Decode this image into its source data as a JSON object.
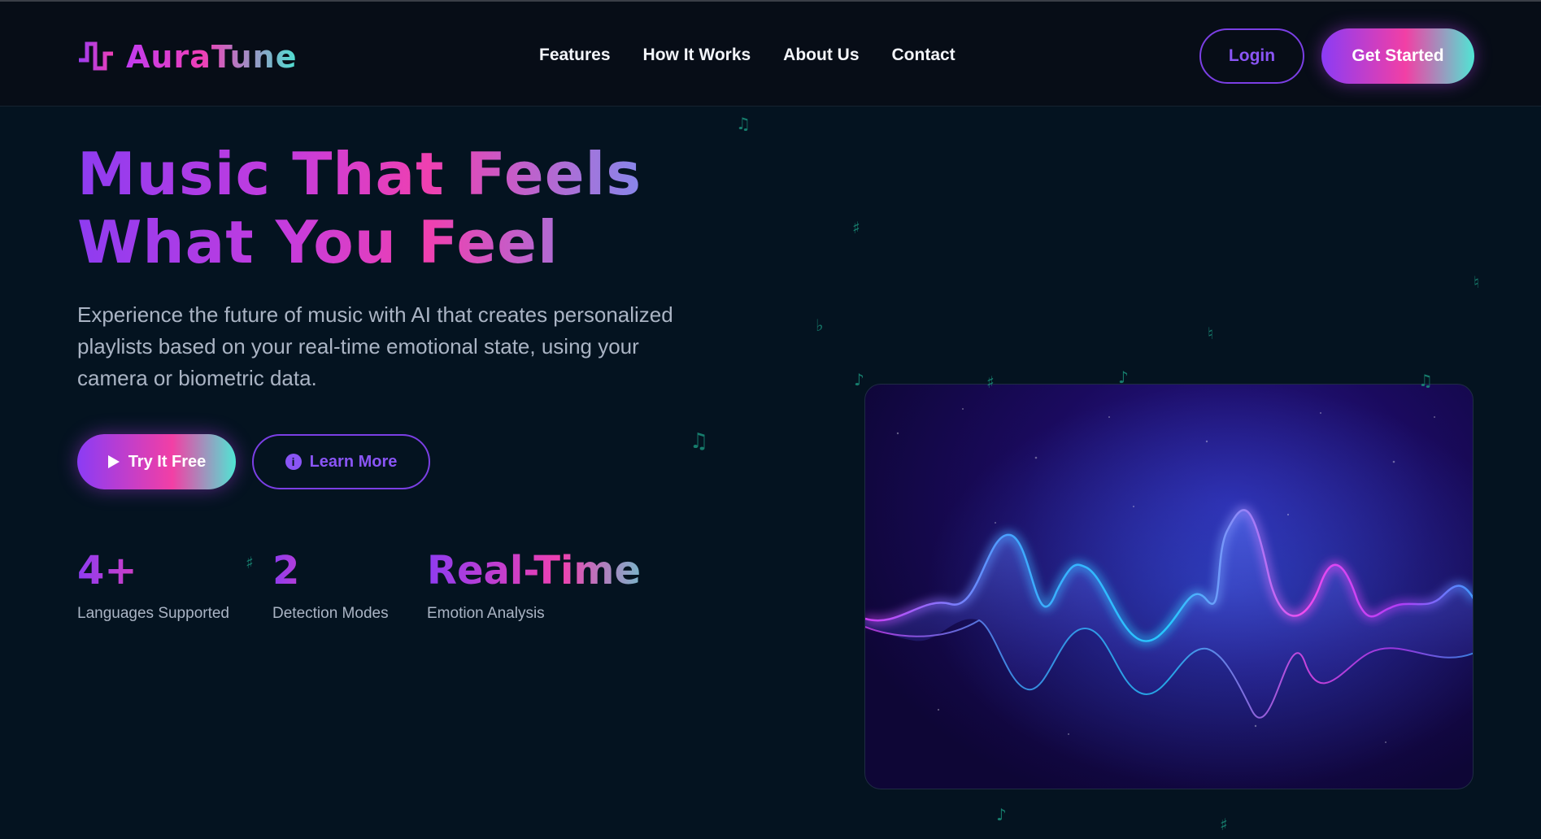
{
  "brand": {
    "name": "AuraTune"
  },
  "nav": {
    "links": [
      "Features",
      "How It Works",
      "About Us",
      "Contact"
    ],
    "login": "Login",
    "get_started": "Get Started"
  },
  "hero": {
    "title_line1": "Music That Feels",
    "title_line2": "What You Feel",
    "description": "Experience the future of music with AI that creates personalized playlists based on your real-time emotional state, using your camera or biometric data.",
    "try_free": "Try It Free",
    "learn_more": "Learn More"
  },
  "stats": [
    {
      "value": "4+",
      "label": "Languages Supported"
    },
    {
      "value": "2",
      "label": "Detection Modes"
    },
    {
      "value": "Real-Time",
      "label": "Emotion Analysis"
    }
  ],
  "colors": {
    "background": "#041320",
    "navbar": "#070d17",
    "accent_purple": "#8b3cf5",
    "accent_pink": "#f23fa5",
    "accent_teal": "#4fe6d4"
  },
  "icons": {
    "logo": "waveform-pulse-icon",
    "try_free": "play-icon",
    "learn_more": "info-icon",
    "decoration": "music-note-icon"
  }
}
